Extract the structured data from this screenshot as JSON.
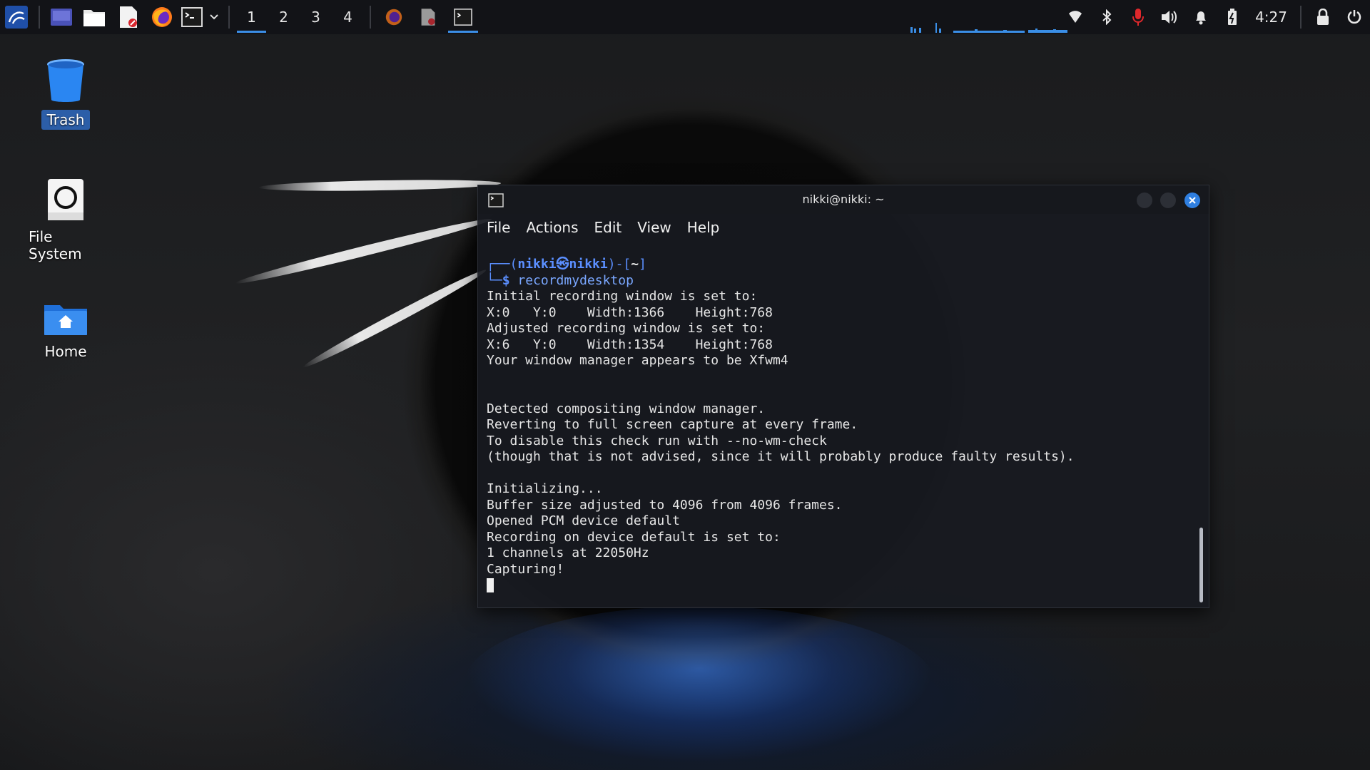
{
  "panel": {
    "workspaces": [
      "1",
      "2",
      "3",
      "4"
    ],
    "active_workspace": "1",
    "clock": "4:27",
    "icons": [
      "kali-menu-icon",
      "workspace-switcher-icon",
      "file-manager-icon",
      "text-editor-icon",
      "firefox-icon",
      "terminal-icon",
      "chevron-down-icon",
      "firefox-task-icon",
      "text-editor-task-icon",
      "terminal-task-icon",
      "wifi-icon",
      "bluetooth-icon",
      "microphone-icon",
      "volume-icon",
      "bell-icon",
      "battery-icon",
      "lock-icon",
      "power-icon"
    ]
  },
  "desktop": {
    "icons": [
      {
        "label": "Trash",
        "icon": "trash-icon"
      },
      {
        "label": "File System",
        "icon": "drive-icon"
      },
      {
        "label": "Home",
        "icon": "home-folder-icon"
      }
    ]
  },
  "terminal": {
    "title": "nikki@nikki: ~",
    "menu": [
      "File",
      "Actions",
      "Edit",
      "View",
      "Help"
    ],
    "prompt": {
      "prefix": "┌──(",
      "user": "nikki",
      "at": "㉿",
      "host": "nikki",
      "path_open": ")-[",
      "path": "~",
      "path_close": "]",
      "line2_prefix": "└─",
      "dollar": "$",
      "command": "recordmydesktop"
    },
    "output": [
      "Initial recording window is set to:",
      "X:0   Y:0    Width:1366    Height:768",
      "Adjusted recording window is set to:",
      "X:6   Y:0    Width:1354    Height:768",
      "Your window manager appears to be Xfwm4",
      "",
      "",
      "Detected compositing window manager.",
      "Reverting to full screen capture at every frame.",
      "To disable this check run with --no-wm-check",
      "(though that is not advised, since it will probably produce faulty results).",
      "",
      "Initializing...",
      "Buffer size adjusted to 4096 from 4096 frames.",
      "Opened PCM device default",
      "Recording on device default is set to:",
      "1 channels at 22050Hz",
      "Capturing!"
    ]
  },
  "colors": {
    "accent": "#3b8ee6",
    "prompt_blue": "#5b8fff",
    "close_button": "#2f7fe0",
    "mic_red": "#e0282c"
  }
}
